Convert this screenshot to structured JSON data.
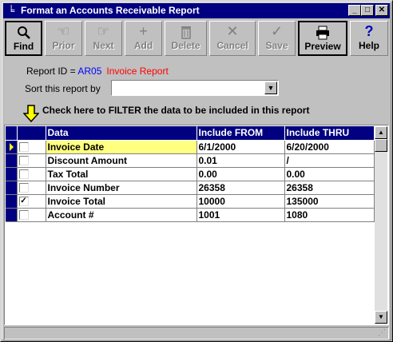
{
  "window": {
    "title": "Format an Accounts Receivable Report",
    "sysmenu_icon": "system-menu-icon",
    "controls": {
      "minimize": "_",
      "maximize": "□",
      "close": "✕"
    }
  },
  "toolbar": [
    {
      "key": "find",
      "label": "Find",
      "icon": "magnifier-icon",
      "glyph": "🔍",
      "enabled": true
    },
    {
      "key": "prior",
      "label": "Prior",
      "icon": "pointing-hand-left-icon",
      "glyph": "☜",
      "enabled": false
    },
    {
      "key": "next",
      "label": "Next",
      "icon": "pointing-hand-right-icon",
      "glyph": "☞",
      "enabled": false
    },
    {
      "key": "add",
      "label": "Add",
      "icon": "plus-icon",
      "glyph": "+",
      "enabled": false
    },
    {
      "key": "delete",
      "label": "Delete",
      "icon": "trash-icon",
      "glyph": "🗑",
      "enabled": false
    },
    {
      "key": "cancel",
      "label": "Cancel",
      "icon": "x-cancel-icon",
      "glyph": "✕",
      "enabled": false
    },
    {
      "key": "save",
      "label": "Save",
      "icon": "checkmark-icon",
      "glyph": "✓",
      "enabled": false
    },
    {
      "key": "preview",
      "label": "Preview",
      "icon": "printer-icon",
      "glyph": "🖨",
      "enabled": true
    },
    {
      "key": "help",
      "label": "Help",
      "icon": "question-mark-icon",
      "glyph": "?",
      "enabled": true
    }
  ],
  "report": {
    "id_label": "Report ID = ",
    "id": "AR05",
    "name": "Invoice Report"
  },
  "sort": {
    "label": "Sort this report by",
    "value": ""
  },
  "filter_hint": "Check here to FILTER the data to be included in this report",
  "grid": {
    "columns": [
      "Data",
      "Include FROM",
      "Include THRU"
    ],
    "rows": [
      {
        "checked": false,
        "data": "Invoice Date",
        "from": "6/1/2000",
        "thru": "6/20/2000",
        "current": true
      },
      {
        "checked": false,
        "data": "Discount Amount",
        "from": "0.01",
        "thru": "/",
        "current": false
      },
      {
        "checked": false,
        "data": "Tax Total",
        "from": "0.00",
        "thru": "0.00",
        "current": false
      },
      {
        "checked": false,
        "data": "Invoice Number",
        "from": "26358",
        "thru": "26358",
        "current": false
      },
      {
        "checked": true,
        "data": "Invoice Total",
        "from": "10000",
        "thru": "135000",
        "current": false
      },
      {
        "checked": false,
        "data": "Account #",
        "from": "1001",
        "thru": "1080",
        "current": false
      }
    ]
  },
  "colors": {
    "title_bar": "#000080",
    "grid_header": "#000080",
    "report_id": "#0000ff",
    "report_name": "#ff0000",
    "current_row": "#ffff80"
  }
}
